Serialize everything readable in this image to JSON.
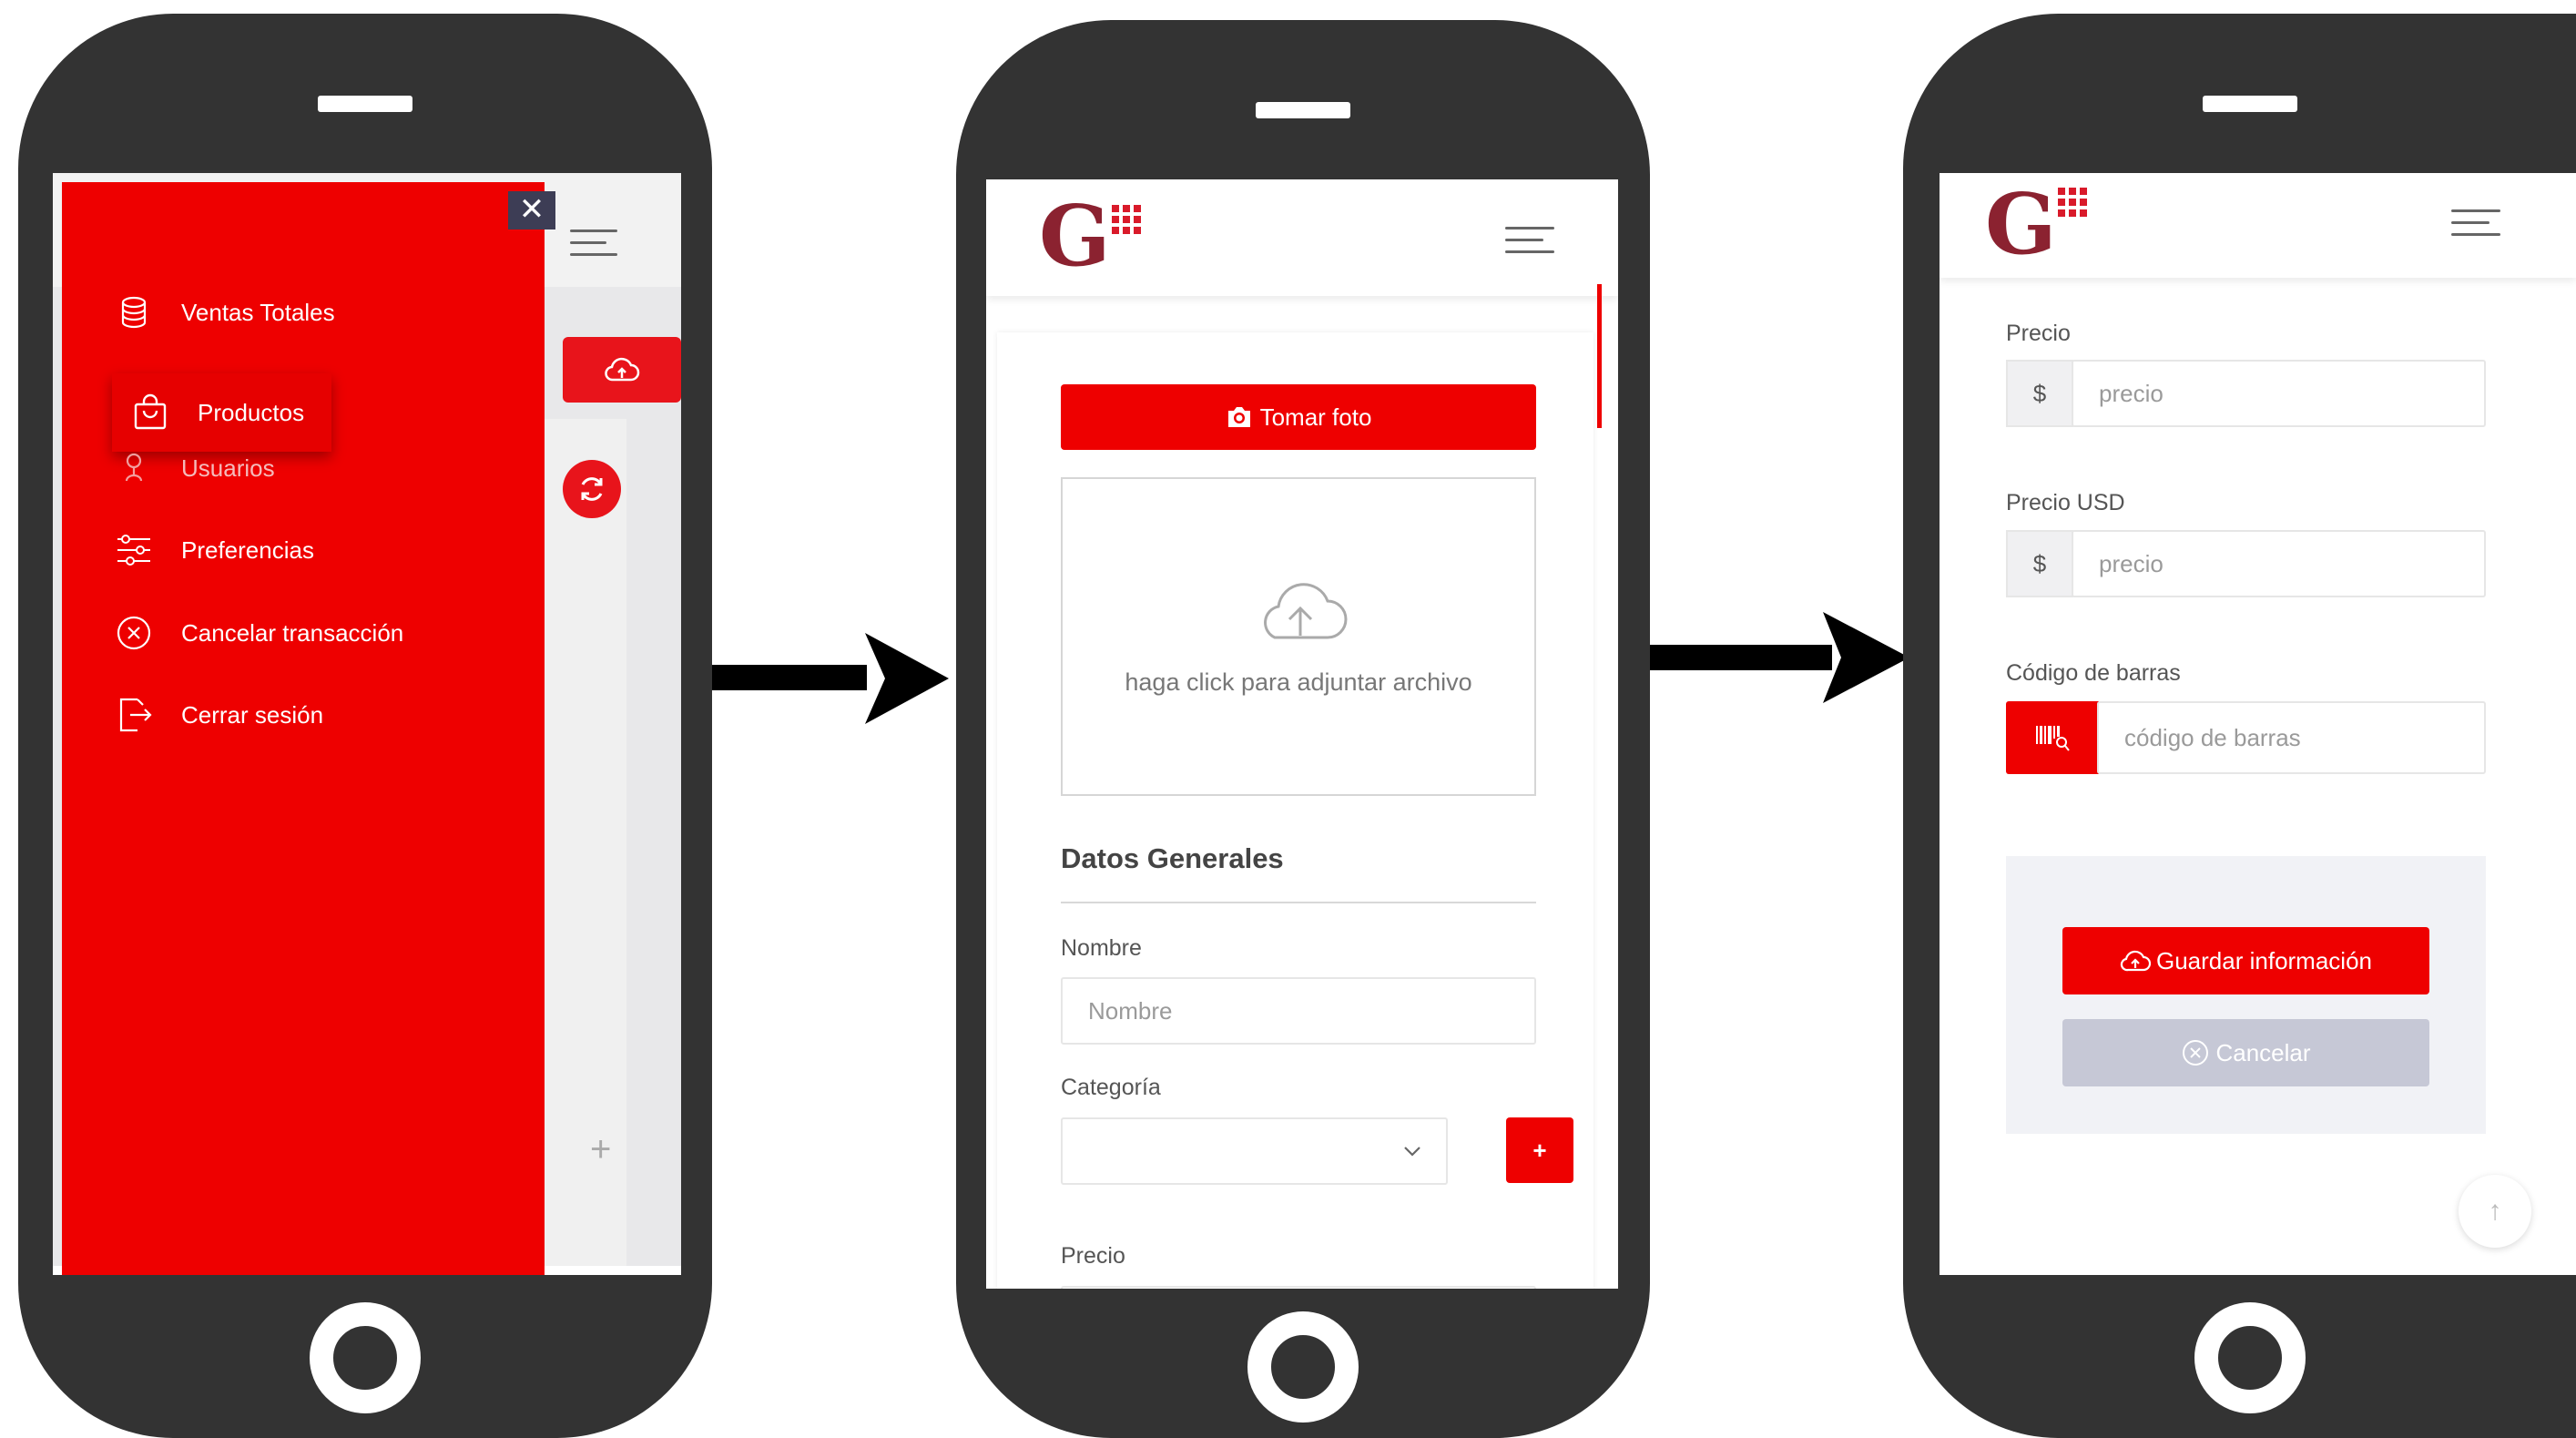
{
  "colors": {
    "brand_red": "#ee0000",
    "phone_body": "#333333",
    "logo_maroon": "#8b2230"
  },
  "logo": {
    "letter": "G"
  },
  "screen1": {
    "menu": [
      {
        "label": "Ventas Totales",
        "icon": "coins-icon"
      },
      {
        "label": "Productos",
        "icon": "shopping-bag-icon",
        "active": true
      },
      {
        "label": "Usuarios",
        "icon": "user-icon"
      },
      {
        "label": "Preferencias",
        "icon": "sliders-icon"
      },
      {
        "label": "Cancelar transacción",
        "icon": "x-circle-icon"
      },
      {
        "label": "Cerrar sesión",
        "icon": "logout-icon"
      }
    ],
    "close_symbol": "✕",
    "plus_symbol": "+"
  },
  "screen2": {
    "take_photo": "Tomar foto",
    "upload_hint": "haga click para adjuntar archivo",
    "section_title": "Datos Generales",
    "name_label": "Nombre",
    "name_placeholder": "Nombre",
    "category_label": "Categoría",
    "add_category": "+",
    "price_label": "Precio"
  },
  "screen3": {
    "price_label": "Precio",
    "price_addon": "$",
    "price_placeholder": "precio",
    "price_usd_label": "Precio USD",
    "price_usd_addon": "$",
    "price_usd_placeholder": "precio",
    "barcode_label": "Código de barras",
    "barcode_placeholder": "código de barras",
    "save_button": "Guardar información",
    "cancel_button": "Cancelar",
    "scroll_top_symbol": "↑"
  }
}
